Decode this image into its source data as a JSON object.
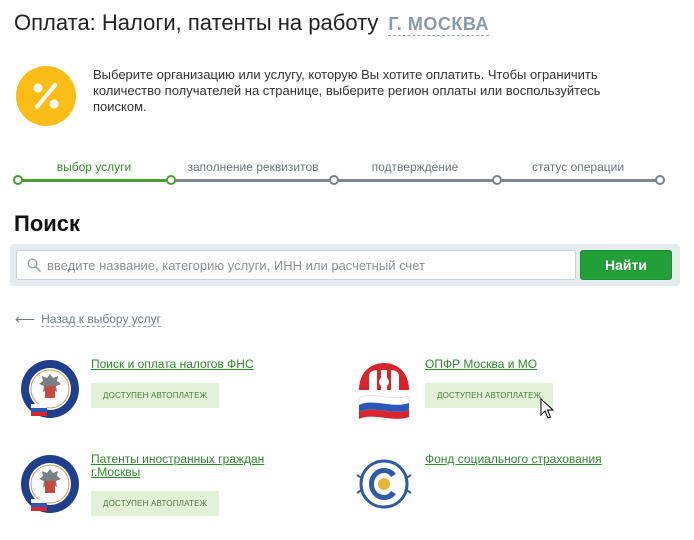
{
  "header": {
    "title": "Оплата: Налоги, патенты на работу",
    "region": "Г. МОСКВА"
  },
  "info": {
    "icon": "percent-icon",
    "text": "Выберите организацию или услугу, которую Вы хотите оплатить. Чтобы ограничить количество получателей на странице, выберите регион оплаты или воспользуйтесь поиском."
  },
  "steps": [
    {
      "label": "выбор услуги",
      "state": "active"
    },
    {
      "label": "заполнение реквизитов",
      "state": "pending"
    },
    {
      "label": "подтверждение",
      "state": "pending"
    },
    {
      "label": "статус операции",
      "state": "pending"
    }
  ],
  "search": {
    "heading": "Поиск",
    "placeholder": "введите название, категорию услуги, ИНН или расчетный счет",
    "value": "",
    "button_label": "Найти"
  },
  "back_link": {
    "arrow": "⟵",
    "label": "Назад к выбору услуг"
  },
  "services": [
    {
      "name": "Поиск и оплата налогов ФНС",
      "badge": "ДОСТУПЕН АВТОПЛАТЕЖ",
      "logo": "fns-emblem-icon"
    },
    {
      "name": "ОПФР Москва и МО",
      "badge": "ДОСТУПЕН АВТОПЛАТЕЖ",
      "logo": "pfr-emblem-icon"
    },
    {
      "name": "Патенты иностранных граждан г.Москвы",
      "badge": "ДОСТУПЕН АВТОПЛАТЕЖ",
      "logo": "fns-emblem-icon"
    },
    {
      "name": "Фонд социального страхования",
      "badge": "",
      "logo": "fss-emblem-icon"
    }
  ],
  "colors": {
    "accent_green": "#21a038",
    "link_green": "#2d8a2c",
    "badge_bg": "#e2f1d8",
    "info_icon_yellow": "#fbbd16"
  }
}
